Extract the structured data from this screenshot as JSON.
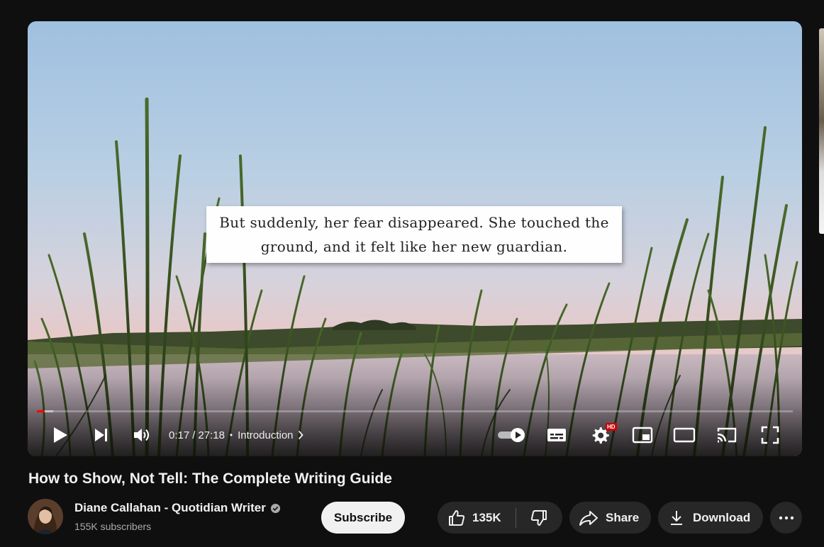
{
  "player": {
    "caption_line1": "But suddenly, her fear disappeared. She touched the",
    "caption_line2": "ground, and it felt like her new guardian.",
    "current_time": "0:17",
    "time_separator": "/",
    "duration": "27:18",
    "chapter_dot": "•",
    "chapter": "Introduction",
    "quality_badge": "HD",
    "progress_fraction": 0.01,
    "buffer_fraction": 0.022,
    "accent_color": "#ff0000",
    "icons": [
      "play-icon",
      "next-icon",
      "volume-icon",
      "chevron-right-icon",
      "autoplay-toggle-icon",
      "subtitles-icon",
      "settings-icon",
      "miniplayer-icon",
      "theater-mode-icon",
      "cast-icon",
      "fullscreen-icon"
    ]
  },
  "video": {
    "title": "How to Show, Not Tell: The Complete Writing Guide"
  },
  "channel": {
    "name": "Diane Callahan - Quotidian Writer",
    "subscribers": "155K subscribers",
    "verified_icon": "verified-check-icon"
  },
  "actions": {
    "subscribe": "Subscribe",
    "like_count": "135K",
    "share": "Share",
    "download": "Download",
    "like_icon": "thumbs-up-icon",
    "dislike_icon": "thumbs-down-icon",
    "share_icon": "share-arrow-icon",
    "download_icon": "download-icon",
    "more_icon": "more-horizontal-icon"
  }
}
